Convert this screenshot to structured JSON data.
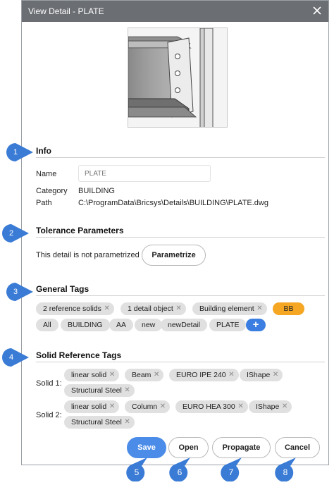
{
  "window": {
    "title": "View Detail - PLATE"
  },
  "info": {
    "heading": "Info",
    "name_label": "Name",
    "name_placeholder": "PLATE",
    "category_label": "Category",
    "category_value": "BUILDING",
    "path_label": "Path",
    "path_value": "C:\\ProgramData\\Bricsys\\Details\\BUILDING\\PLATE.dwg"
  },
  "tolerance": {
    "heading": "Tolerance Parameters",
    "message": "This detail is not parametrized",
    "parametrize_label": "Parametrize"
  },
  "general_tags": {
    "heading": "General Tags",
    "removable": [
      "2 reference solids",
      "1 detail object",
      "Building element"
    ],
    "highlighted": "BB",
    "options": [
      "All",
      "BUILDING",
      "AA",
      "new",
      "newDetail",
      "PLATE"
    ],
    "add_label": "+"
  },
  "solid_tags": {
    "heading": "Solid Reference Tags",
    "solid1_label": "Solid 1:",
    "solid1_tags": [
      "linear solid",
      "Beam",
      "EURO IPE 240",
      "IShape",
      "Structural Steel"
    ],
    "solid2_label": "Solid 2:",
    "solid2_tags": [
      "linear solid",
      "Column",
      "EURO HEA 300",
      "IShape",
      "Structural Steel"
    ]
  },
  "buttons": {
    "save": "Save",
    "open": "Open",
    "propagate": "Propagate",
    "cancel": "Cancel"
  },
  "callouts": [
    "1",
    "2",
    "3",
    "4",
    "5",
    "6",
    "7",
    "8"
  ],
  "colors": {
    "titlebar": "#6b6e73",
    "accent": "#4a8ce8",
    "callout": "#3a7bd5",
    "highlight_tag": "#f5a623"
  }
}
